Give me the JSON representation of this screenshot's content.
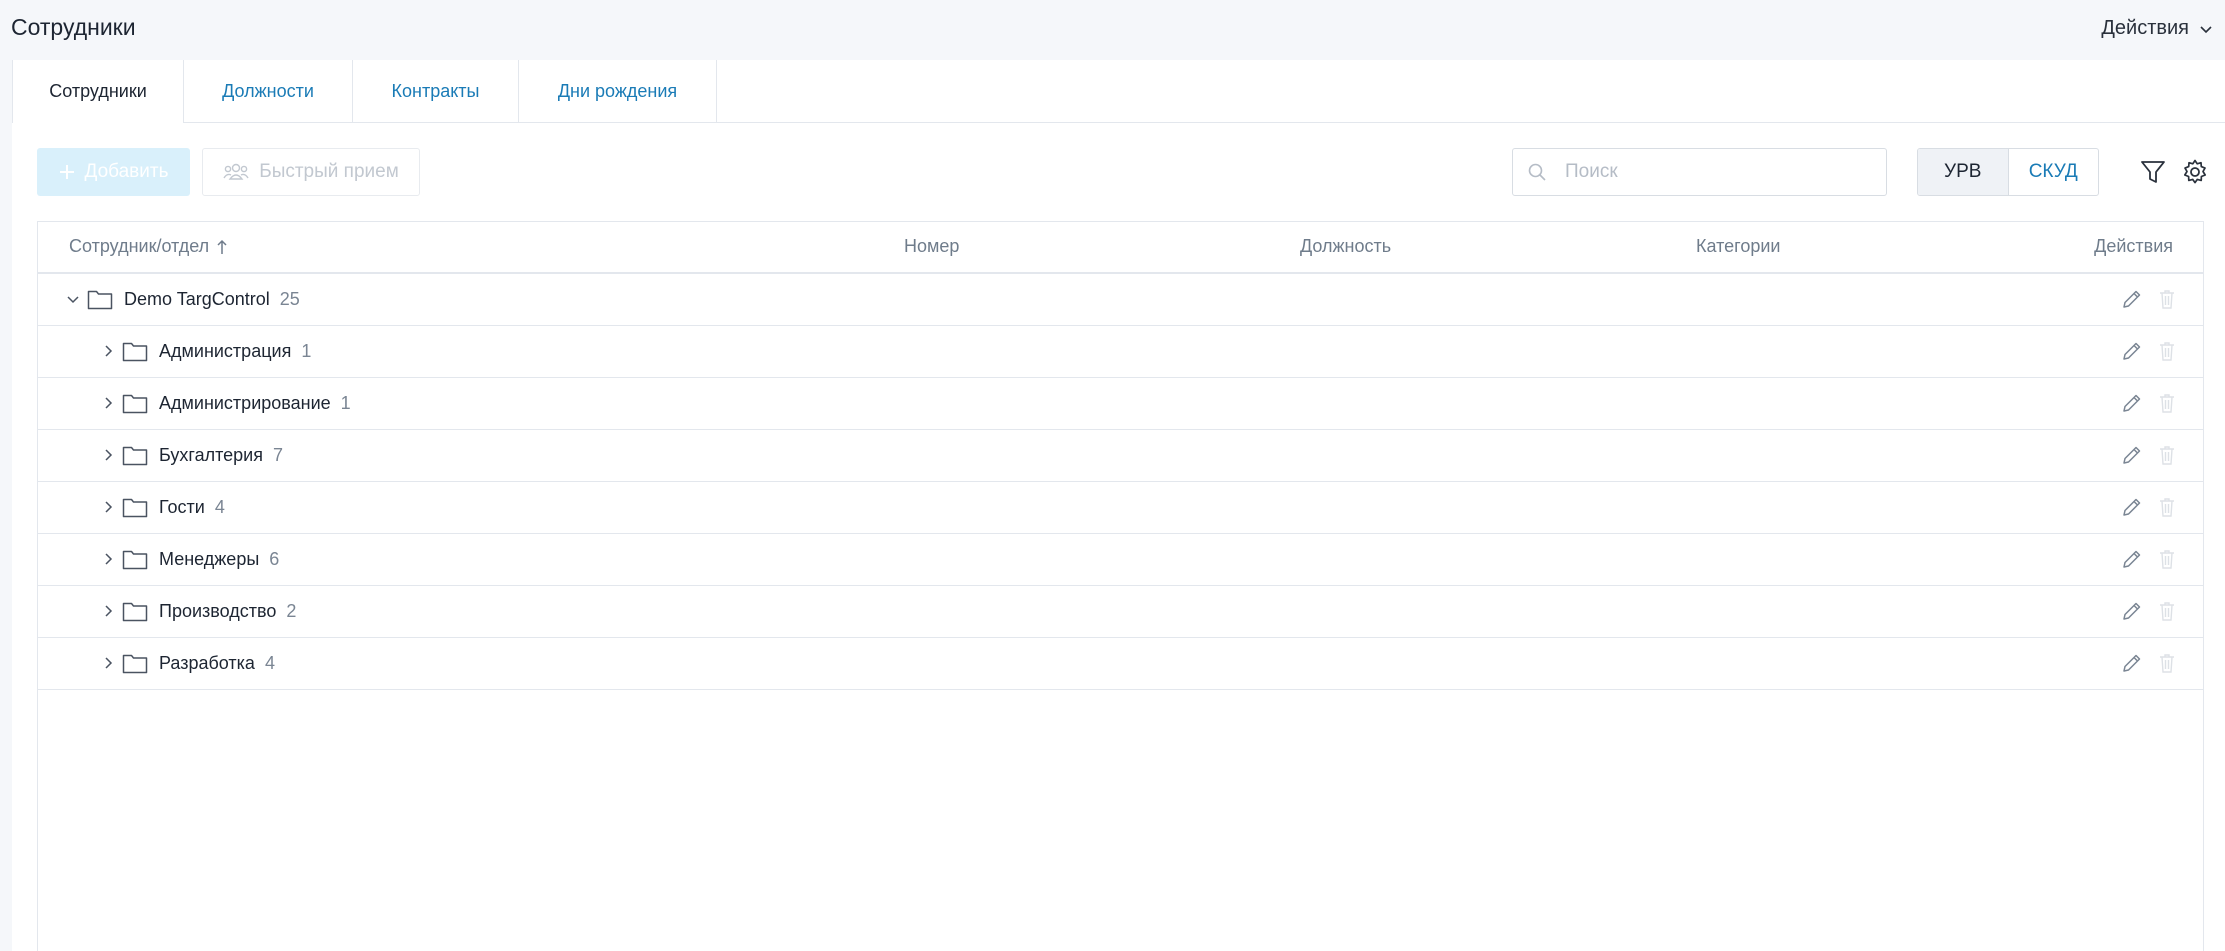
{
  "header": {
    "title": "Сотрудники",
    "actions_label": "Действия"
  },
  "tabs": [
    {
      "label": "Сотрудники",
      "active": true
    },
    {
      "label": "Должности",
      "active": false
    },
    {
      "label": "Контракты",
      "active": false
    },
    {
      "label": "Дни рождения",
      "active": false
    }
  ],
  "toolbar": {
    "add_label": "Добавить",
    "quick_label": "Быстрый прием",
    "search_placeholder": "Поиск",
    "mode_active": "УРВ",
    "mode_other": "СКУД"
  },
  "table": {
    "columns": {
      "employee": "Сотрудник/отдел",
      "number": "Номер",
      "position": "Должность",
      "categories": "Категории",
      "actions": "Действия"
    },
    "root": {
      "name": "Demo TargControl",
      "count": "25"
    },
    "rows": [
      {
        "name": "Администрация",
        "count": "1"
      },
      {
        "name": "Администрирование",
        "count": "1"
      },
      {
        "name": "Бухгалтерия",
        "count": "7"
      },
      {
        "name": "Гости",
        "count": "4"
      },
      {
        "name": "Менеджеры",
        "count": "6"
      },
      {
        "name": "Производство",
        "count": "2"
      },
      {
        "name": "Разработка",
        "count": "4"
      }
    ]
  },
  "colors": {
    "link": "#1a7bb6",
    "add_button_bg": "#d9f0fb",
    "border": "#e3e7ed"
  }
}
